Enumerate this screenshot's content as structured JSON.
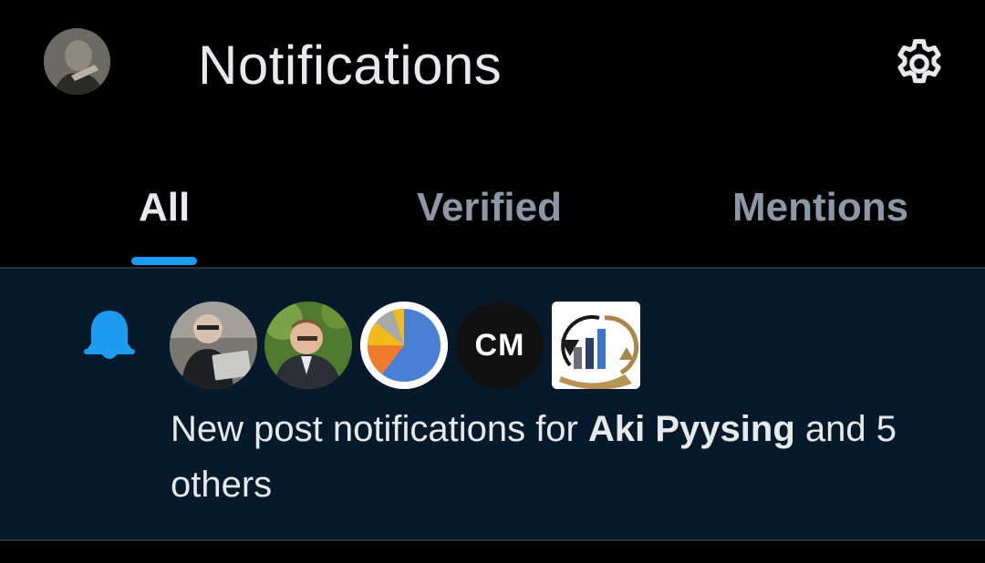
{
  "header": {
    "title": "Notifications",
    "profile_avatar": "user-profile-avatar",
    "settings_icon": "gear-icon"
  },
  "tabs": [
    {
      "label": "All",
      "active": true
    },
    {
      "label": "Verified",
      "active": false
    },
    {
      "label": "Mentions",
      "active": false
    }
  ],
  "notification": {
    "icon": "bell-icon",
    "prefix": "New post notifications for ",
    "name": "Aki Pyysing",
    "suffix": " and 5 others",
    "avatars": [
      {
        "icon": "person-with-laptop-avatar"
      },
      {
        "icon": "person-portrait-avatar"
      },
      {
        "icon": "pie-chart-avatar"
      },
      {
        "label": "CM"
      },
      {
        "icon": "bar-chart-logo-avatar"
      }
    ]
  },
  "colors": {
    "background": "#000000",
    "notification_background": "#061a2b",
    "accent": "#1d9bf0",
    "text_primary": "#e7e9ea",
    "text_secondary": "#8b98a5",
    "divider": "#2f3336"
  }
}
